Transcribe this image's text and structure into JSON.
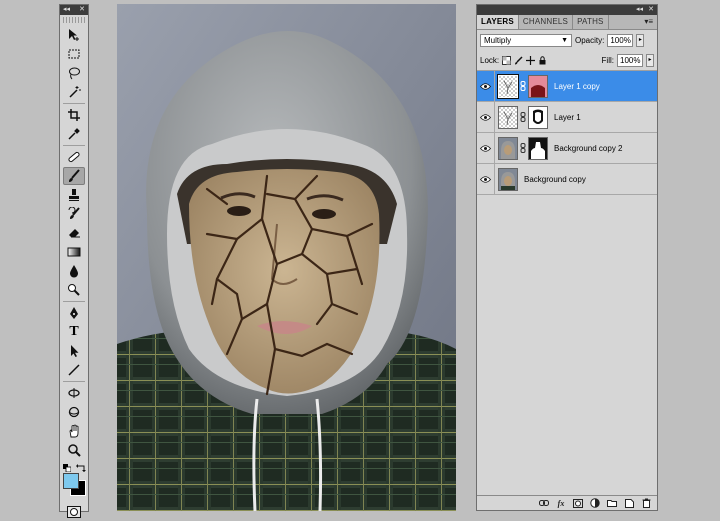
{
  "colors": {
    "foreground": "#7ec9ee",
    "background": "#000000",
    "selection": "#3b8ce8"
  },
  "tools": [
    {
      "name": "move-tool",
      "icon": "move-icon"
    },
    {
      "name": "marquee-tool",
      "icon": "rect-marquee-icon"
    },
    {
      "name": "lasso-tool",
      "icon": "lasso-icon"
    },
    {
      "name": "magic-wand-tool",
      "icon": "magic-wand-icon"
    },
    {
      "name": "crop-tool",
      "icon": "crop-icon"
    },
    {
      "name": "eyedropper-tool",
      "icon": "eyedropper-icon"
    },
    {
      "name": "healing-brush-tool",
      "icon": "bandage-icon"
    },
    {
      "name": "brush-tool",
      "icon": "brush-icon",
      "active": true
    },
    {
      "name": "clone-stamp-tool",
      "icon": "stamp-icon"
    },
    {
      "name": "history-brush-tool",
      "icon": "history-brush-icon"
    },
    {
      "name": "eraser-tool",
      "icon": "eraser-icon"
    },
    {
      "name": "gradient-tool",
      "icon": "gradient-icon"
    },
    {
      "name": "blur-tool",
      "icon": "drop-icon"
    },
    {
      "name": "dodge-tool",
      "icon": "dodge-icon"
    },
    {
      "name": "pen-tool",
      "icon": "pen-icon"
    },
    {
      "name": "type-tool",
      "icon": "type-icon",
      "glyph": "T"
    },
    {
      "name": "path-selection-tool",
      "icon": "arrow-icon"
    },
    {
      "name": "line-tool",
      "icon": "line-icon"
    },
    {
      "name": "3d-rotate-tool",
      "icon": "3d-rotate-icon"
    },
    {
      "name": "3d-orbit-tool",
      "icon": "3d-orbit-icon"
    },
    {
      "name": "hand-tool",
      "icon": "hand-icon"
    },
    {
      "name": "zoom-tool",
      "icon": "zoom-icon"
    }
  ],
  "layers_panel": {
    "tabs": [
      "LAYERS",
      "CHANNELS",
      "PATHS"
    ],
    "active_tab": "LAYERS",
    "blend_mode": "Multiply",
    "opacity_label": "Opacity:",
    "opacity_value": "100%",
    "lock_label": "Lock:",
    "fill_label": "Fill:",
    "fill_value": "100%",
    "layers": [
      {
        "name": "Layer 1 copy",
        "selected": true,
        "has_mask": true
      },
      {
        "name": "Layer 1",
        "selected": false,
        "has_mask": true
      },
      {
        "name": "Background copy 2",
        "selected": false,
        "has_mask": true
      },
      {
        "name": "Background copy",
        "selected": false,
        "has_mask": false
      }
    ],
    "footer_buttons": [
      "link-icon",
      "fx-icon",
      "add-mask-icon",
      "adjustment-icon",
      "group-icon",
      "new-layer-icon",
      "trash-icon"
    ]
  }
}
